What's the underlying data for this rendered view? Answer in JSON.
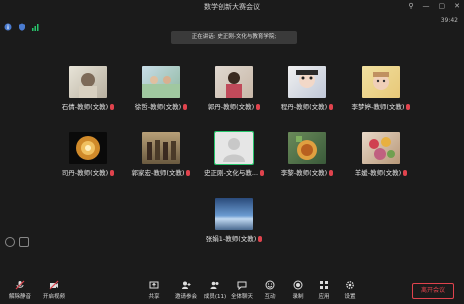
{
  "window": {
    "title": "数学创新大赛会议"
  },
  "status": {
    "time": "39:42",
    "speaking": "正在讲话: 史正刚-文化与教育学院;"
  },
  "participants": [
    {
      "name": "石倩-教师(文教)"
    },
    {
      "name": "徐哲-教师(文教)"
    },
    {
      "name": "郭丹-教师(文教)"
    },
    {
      "name": "程丹-教师(文教)"
    },
    {
      "name": "李梦婷-教师(文教)"
    },
    {
      "name": "司丹-教师(文教)"
    },
    {
      "name": "郭家宏-教师(文教)"
    },
    {
      "name": "史正刚-文化与教..."
    },
    {
      "name": "李黎-教师(文教)"
    },
    {
      "name": "羊媛-教师(文教)"
    },
    {
      "name": "张娟1-教师(文教)"
    }
  ],
  "toolbar": {
    "mute": "解除静音",
    "video": "开启视频",
    "share": "共享",
    "invite": "邀请参会",
    "members": "成员(11)",
    "chat": "全体聊天",
    "interact": "互动",
    "record": "录制",
    "apps": "应用",
    "settings": "设置",
    "leave": "离开会议"
  },
  "colors": {
    "accent_green": "#27c46b",
    "mute_red": "#e0434d",
    "leave_red": "#e0434d"
  }
}
